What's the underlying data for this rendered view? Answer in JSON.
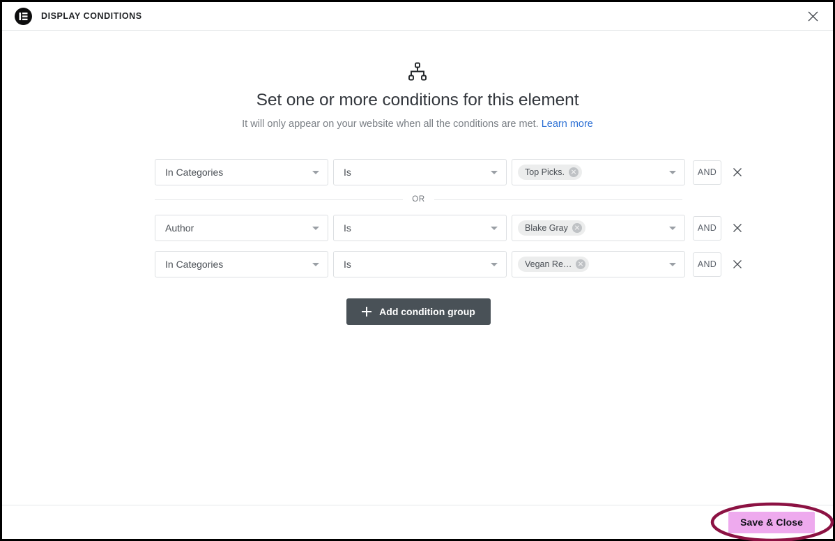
{
  "header": {
    "logo_icon": "elementor-logo-icon",
    "title": "DISPLAY CONDITIONS",
    "close_icon": "close-icon"
  },
  "intro": {
    "icon": "sitemap-hierarchy-icon",
    "title": "Set one or more conditions for this element",
    "subtitle": "It will only appear on your website when all the conditions are met.",
    "learn_more_label": "Learn more"
  },
  "divider": {
    "or_label": "OR"
  },
  "condition_groups": [
    {
      "rows": [
        {
          "type": "In Categories",
          "operator": "Is",
          "chip": "Top Picks.",
          "chip_remove_icon": "chip-remove-icon",
          "logic": "AND",
          "remove_icon": "close-icon"
        }
      ]
    },
    {
      "rows": [
        {
          "type": "Author",
          "operator": "Is",
          "chip": "Blake Gray",
          "chip_remove_icon": "chip-remove-icon",
          "logic": "AND",
          "remove_icon": "close-icon"
        },
        {
          "type": "In Categories",
          "operator": "Is",
          "chip": "Vegan Re…",
          "chip_remove_icon": "chip-remove-icon",
          "logic": "AND",
          "remove_icon": "close-icon"
        }
      ]
    }
  ],
  "actions": {
    "add_group_label": "Add condition group",
    "add_group_icon": "plus-icon",
    "save_label": "Save & Close"
  },
  "colors": {
    "accent_link": "#2b6fd4",
    "add_group_bg": "#495157",
    "save_bg": "#eeaaee",
    "annotation": "#8c1243",
    "chip_bg": "#eceded"
  }
}
